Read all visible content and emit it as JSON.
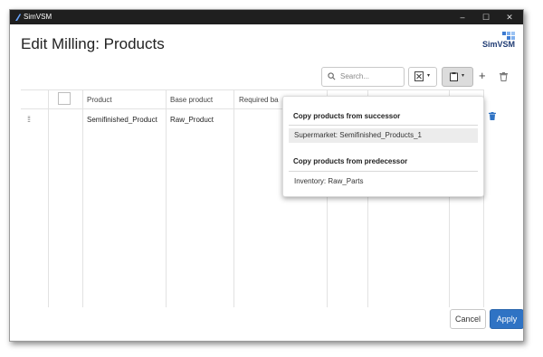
{
  "window": {
    "title": "SimVSM",
    "minimize": "–",
    "maximize": "☐",
    "close": "✕"
  },
  "dialog": {
    "heading": "Edit Milling: Products",
    "logo_text": "SimVSM"
  },
  "toolbar": {
    "search_placeholder": "Search...",
    "excel_caret": "▾",
    "copy_caret": "▾",
    "add": "+"
  },
  "table": {
    "columns": [
      "Product",
      "Base product",
      "Required ba"
    ],
    "rows": [
      {
        "product": "Semifinished_Product",
        "base_product": "Raw_Product"
      }
    ]
  },
  "dropdown": {
    "successor_heading": "Copy products from successor",
    "successor_items": [
      "Supermarket: Semifinished_Products_1"
    ],
    "predecessor_heading": "Copy products from predecessor",
    "predecessor_items": [
      "Inventory: Raw_Parts"
    ]
  },
  "footer": {
    "cancel": "Cancel",
    "apply": "Apply"
  },
  "colors": {
    "accent": "#2f73c4",
    "titlebar": "#1f1f1f"
  }
}
